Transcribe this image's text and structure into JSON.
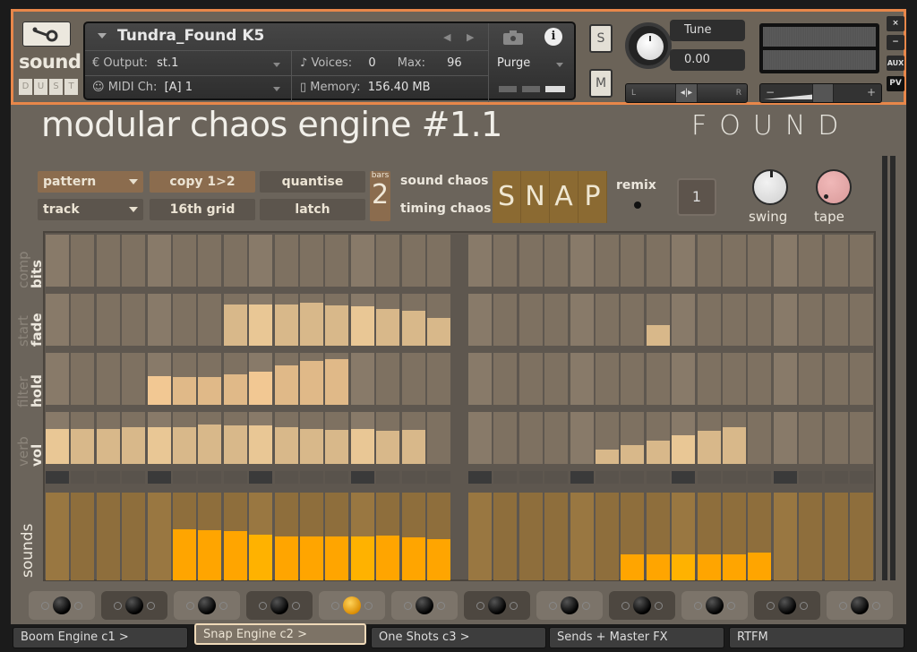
{
  "header": {
    "instrument_name": "Tundra_Found K5",
    "logo_text": "sound",
    "logo_sub": [
      "D",
      "U",
      "S",
      "T"
    ],
    "output_label": "Output:",
    "output_value": "st.1",
    "midi_label": "MIDI Ch:",
    "midi_value": "[A]  1",
    "voices_label": "Voices:",
    "voices_value": "0",
    "max_label": "Max:",
    "max_value": "96",
    "memory_label": "Memory:",
    "memory_value": "156.40 MB",
    "purge_label": "Purge",
    "solo_label": "S",
    "mute_label": "M",
    "tune_label": "Tune",
    "tune_value": "0.00",
    "pan_left": "L",
    "pan_right": "R",
    "vol_minus": "−",
    "vol_plus": "+",
    "side_buttons": [
      "×",
      "−",
      "AUX",
      "PV"
    ]
  },
  "main": {
    "title": "modular chaos engine #1.1",
    "brand": "FOUND",
    "controls": {
      "pattern": "pattern",
      "track": "track",
      "copy": "copy 1>2",
      "grid16": "16th grid",
      "quantise": "quantise",
      "latch": "latch",
      "bars_label": "bars",
      "bars_value": "2",
      "sound_chaos": "sound chaos",
      "timing_chaos": "timing chaos",
      "snap_letters": [
        "S",
        "N",
        "A",
        "P"
      ],
      "remix": "remix",
      "counter": "1",
      "swing": "swing",
      "tape": "tape"
    },
    "rows": [
      {
        "alt": "comp",
        "label": "bits"
      },
      {
        "alt": "start",
        "label": "fade"
      },
      {
        "alt": "filter",
        "label": "hold"
      },
      {
        "alt": "verb",
        "label": "vol"
      },
      {
        "alt": "",
        "label": "sounds"
      }
    ],
    "sequencer": {
      "steps_per_half": 16,
      "bits": [
        [
          0,
          0,
          0,
          0,
          0,
          0,
          0,
          0,
          0,
          0,
          0,
          0,
          0,
          0,
          0,
          0
        ],
        [
          0,
          0,
          0,
          0,
          0,
          0,
          0,
          0,
          0,
          0,
          0,
          0,
          0,
          0,
          0,
          0
        ]
      ],
      "fade": [
        [
          0,
          0,
          0,
          0,
          0,
          0,
          0,
          0.8,
          0.8,
          0.8,
          0.82,
          0.78,
          0.76,
          0.71,
          0.67,
          0.53
        ],
        [
          0,
          0,
          0,
          0,
          0,
          0,
          0,
          0.4,
          0,
          0,
          0,
          0,
          0,
          0,
          0,
          0
        ]
      ],
      "hold": [
        [
          0,
          0,
          0,
          0,
          0.55,
          0.53,
          0.53,
          0.59,
          0.64,
          0.76,
          0.84,
          0.88,
          0,
          0,
          0,
          0
        ],
        [
          0,
          0,
          0,
          0,
          0,
          0,
          0,
          0,
          0,
          0,
          0,
          0,
          0,
          0,
          0,
          0
        ]
      ],
      "vol": [
        [
          0.68,
          0.68,
          0.68,
          0.71,
          0.71,
          0.71,
          0.76,
          0.74,
          0.74,
          0.71,
          0.68,
          0.66,
          0.68,
          0.64,
          0.66,
          0
        ],
        [
          0,
          0,
          0,
          0,
          0,
          0.28,
          0.36,
          0.45,
          0.56,
          0.64,
          0.7,
          0,
          0,
          0,
          0,
          0
        ]
      ],
      "sounds": [
        [
          0,
          0,
          0,
          0,
          0,
          0.58,
          0.57,
          0.56,
          0.52,
          0.5,
          0.5,
          0.5,
          0.5,
          0.51,
          0.49,
          0.47
        ],
        [
          0,
          0,
          0,
          0,
          0,
          0,
          0.3,
          0.3,
          0.3,
          0.3,
          0.3,
          0.32,
          0,
          0,
          0,
          0
        ]
      ]
    },
    "jacks": [
      {
        "active": false,
        "shade": "light"
      },
      {
        "active": false,
        "shade": "dark"
      },
      {
        "active": false,
        "shade": "light"
      },
      {
        "active": false,
        "shade": "dark"
      },
      {
        "active": true,
        "shade": "light"
      },
      {
        "active": false,
        "shade": "light"
      },
      {
        "active": false,
        "shade": "dark"
      },
      {
        "active": false,
        "shade": "light"
      },
      {
        "active": false,
        "shade": "dark"
      },
      {
        "active": false,
        "shade": "light"
      },
      {
        "active": false,
        "shade": "dark"
      },
      {
        "active": false,
        "shade": "light"
      }
    ]
  },
  "tabs": [
    {
      "label": "Boom Engine c1 >",
      "active": false
    },
    {
      "label": "Snap Engine c2 >",
      "active": true
    },
    {
      "label": "One Shots c3 >",
      "active": false
    },
    {
      "label": "Sends + Master FX",
      "active": false
    },
    {
      "label": "RTFM",
      "active": false
    }
  ],
  "colors": {
    "accent_border": "#e8874a",
    "param_fill": "#d8b88a",
    "sound_fill": "#ffa500",
    "panel": "#6b645b"
  }
}
